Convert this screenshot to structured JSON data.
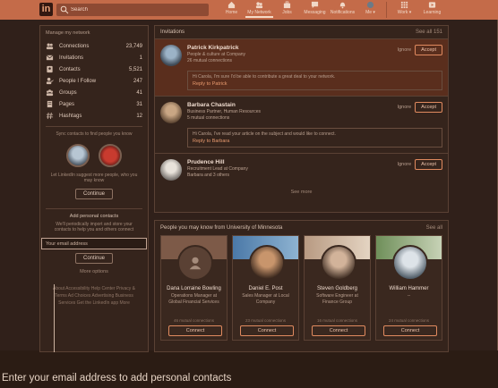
{
  "topbar": {
    "logo": "in",
    "search_placeholder": "Search",
    "nav": [
      {
        "label": "Home",
        "icon": "home-icon"
      },
      {
        "label": "My Network",
        "icon": "network-icon",
        "active": true
      },
      {
        "label": "Jobs",
        "icon": "briefcase-icon"
      },
      {
        "label": "Messaging",
        "icon": "chat-icon"
      },
      {
        "label": "Notifications",
        "icon": "bell-icon"
      },
      {
        "label": "Me ▾",
        "icon": "avatar-icon"
      },
      {
        "label": "Work ▾",
        "icon": "grid-icon"
      },
      {
        "label": "Learning",
        "icon": "play-icon"
      }
    ]
  },
  "sidebar": {
    "title": "Manage my network",
    "items": [
      {
        "label": "Connections",
        "count": "23,749",
        "icon": "people-icon"
      },
      {
        "label": "Invitations",
        "count": "1",
        "icon": "envelope-icon"
      },
      {
        "label": "Contacts",
        "count": "5,521",
        "icon": "contacts-icon"
      },
      {
        "label": "People I Follow",
        "count": "247",
        "icon": "person-check-icon"
      },
      {
        "label": "Groups",
        "count": "41",
        "icon": "groups-icon"
      },
      {
        "label": "Pages",
        "count": "31",
        "icon": "pages-icon"
      },
      {
        "label": "Hashtags",
        "count": "12",
        "icon": "hashtag-icon"
      }
    ],
    "sync_text": "Sync contacts to find people you know",
    "more_text": "Let LinkedIn suggest more people, who you may know",
    "continue_label": "Continue",
    "add_title": "Add personal contacts",
    "add_desc": "We'll periodically import and store your contacts to help you and others connect",
    "email_placeholder": "Your email address",
    "continue2_label": "Continue",
    "more_options": "More options",
    "footer": "About  Accessibility  Help Center  Privacy & Terms  Ad Choices  Advertising  Business Services  Get the LinkedIn app  More"
  },
  "invitations": {
    "title": "Invitations",
    "see_all": "See all 151",
    "see_more": "See more",
    "ignore_label": "Ignore",
    "accept_label": "Accept",
    "items": [
      {
        "name": "Patrick Kirkpatrick",
        "sub": "People & culture at Company",
        "sub2": "26 mutual connections",
        "message": "Hi Carola, I'm sure I'd be able to contribute a great deal to your network.",
        "reply": "Reply to Patrick"
      },
      {
        "name": "Barbara Chastain",
        "sub": "Business Partner, Human Resources",
        "sub2": "5 mutual connections",
        "message": "Hi Carola, I've read your article on the subject and would like to connect.",
        "reply": "Reply to Barbara"
      },
      {
        "name": "Prudence Hill",
        "sub": "Recruitment Lead at Company",
        "sub2": "Barbara and 3 others",
        "message": "",
        "reply": ""
      }
    ]
  },
  "pymk": {
    "title": "People you may know from University of Minnesota",
    "see_all": "See all",
    "connect_label": "Connect",
    "people": [
      {
        "name": "Dana Lorraine Bowling",
        "title": "Operations Manager at Global Financial Services",
        "mutual": "46 mutual connections"
      },
      {
        "name": "Daniel E. Post",
        "title": "Sales Manager at Local Company",
        "mutual": "23 mutual connections"
      },
      {
        "name": "Steven Goldberg",
        "title": "Software Engineer at Finance Group",
        "mutual": "16 mutual connections"
      },
      {
        "name": "William Hammer",
        "title": "--",
        "mutual": "24 mutual connections"
      }
    ]
  },
  "caption": "Enter your email address to add personal contacts",
  "colors": {
    "accent": "#c46b49",
    "background": "#30201a",
    "panel": "#35241c"
  }
}
